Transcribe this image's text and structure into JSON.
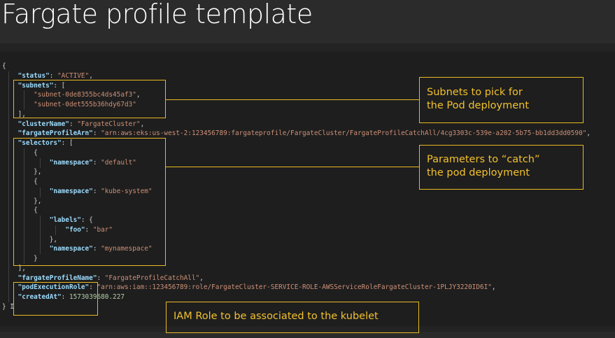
{
  "slide": {
    "title": "Fargate profile template"
  },
  "code_lines": [
    [
      {
        "t": "p",
        "v": "{"
      }
    ],
    [
      {
        "t": "p",
        "v": "    "
      },
      {
        "t": "k",
        "v": "\"status\""
      },
      {
        "t": "p",
        "v": ": "
      },
      {
        "t": "s",
        "v": "\"ACTIVE\""
      },
      {
        "t": "p",
        "v": ","
      }
    ],
    [
      {
        "t": "p",
        "v": "    "
      },
      {
        "t": "k",
        "v": "\"subnets\""
      },
      {
        "t": "p",
        "v": ": ["
      }
    ],
    [
      {
        "t": "p",
        "v": "        "
      },
      {
        "t": "s",
        "v": "\"subnet-0de8355bc4ds45af3\""
      },
      {
        "t": "p",
        "v": ","
      }
    ],
    [
      {
        "t": "p",
        "v": "        "
      },
      {
        "t": "s",
        "v": "\"subnet-0det555b36hdy67d3\""
      }
    ],
    [
      {
        "t": "p",
        "v": "    ],"
      }
    ],
    [
      {
        "t": "p",
        "v": "    "
      },
      {
        "t": "k",
        "v": "\"clusterName\""
      },
      {
        "t": "p",
        "v": ": "
      },
      {
        "t": "s",
        "v": "\"FargateCluster\""
      },
      {
        "t": "p",
        "v": ","
      }
    ],
    [
      {
        "t": "p",
        "v": "    "
      },
      {
        "t": "k",
        "v": "\"fargateProfileArn\""
      },
      {
        "t": "p",
        "v": ": "
      },
      {
        "t": "s",
        "v": "\"arn:aws:eks:us-west-2:123456789:fargateprofile/FargateCluster/FargateProfileCatchAll/4cg3303c-539e-a202-5b75-bb1dd3dd0590\""
      },
      {
        "t": "p",
        "v": ","
      }
    ],
    [
      {
        "t": "p",
        "v": "    "
      },
      {
        "t": "k",
        "v": "\"selectors\""
      },
      {
        "t": "p",
        "v": ": ["
      }
    ],
    [
      {
        "t": "p",
        "v": "        {"
      }
    ],
    [
      {
        "t": "p",
        "v": "            "
      },
      {
        "t": "k",
        "v": "\"namespace\""
      },
      {
        "t": "p",
        "v": ": "
      },
      {
        "t": "s",
        "v": "\"default\""
      }
    ],
    [
      {
        "t": "p",
        "v": "        },"
      }
    ],
    [
      {
        "t": "p",
        "v": "        {"
      }
    ],
    [
      {
        "t": "p",
        "v": "            "
      },
      {
        "t": "k",
        "v": "\"namespace\""
      },
      {
        "t": "p",
        "v": ": "
      },
      {
        "t": "s",
        "v": "\"kube-system\""
      }
    ],
    [
      {
        "t": "p",
        "v": "        },"
      }
    ],
    [
      {
        "t": "p",
        "v": "        {"
      }
    ],
    [
      {
        "t": "p",
        "v": "            "
      },
      {
        "t": "k",
        "v": "\"labels\""
      },
      {
        "t": "p",
        "v": ": {"
      }
    ],
    [
      {
        "t": "p",
        "v": "                "
      },
      {
        "t": "k",
        "v": "\"foo\""
      },
      {
        "t": "p",
        "v": ": "
      },
      {
        "t": "s",
        "v": "\"bar\""
      }
    ],
    [
      {
        "t": "p",
        "v": "            },"
      }
    ],
    [
      {
        "t": "p",
        "v": "            "
      },
      {
        "t": "k",
        "v": "\"namespace\""
      },
      {
        "t": "p",
        "v": ": "
      },
      {
        "t": "s",
        "v": "\"mynamespace\""
      }
    ],
    [
      {
        "t": "p",
        "v": "        }"
      }
    ],
    [
      {
        "t": "p",
        "v": "    ],"
      }
    ],
    [
      {
        "t": "p",
        "v": "    "
      },
      {
        "t": "k",
        "v": "\"fargateProfileName\""
      },
      {
        "t": "p",
        "v": ": "
      },
      {
        "t": "s",
        "v": "\"FargateProfileCatchAll\""
      },
      {
        "t": "p",
        "v": ","
      }
    ],
    [
      {
        "t": "p",
        "v": "    "
      },
      {
        "t": "k",
        "v": "\"podExecutionRole\""
      },
      {
        "t": "p",
        "v": ": "
      },
      {
        "t": "s",
        "v": "\"arn:aws:iam::123456789:role/FargateCluster-SERVICE-ROLE-AWSServiceRoleFargateCluster-1PLJY3220ID6I\""
      },
      {
        "t": "p",
        "v": ","
      }
    ],
    [
      {
        "t": "p",
        "v": "    "
      },
      {
        "t": "k",
        "v": "\"createdAt\""
      },
      {
        "t": "p",
        "v": ": "
      },
      {
        "t": "n",
        "v": "1573039680.227"
      }
    ],
    [
      {
        "t": "p",
        "v": "} "
      },
      {
        "t": "c",
        "v": "I"
      }
    ]
  ],
  "callouts": {
    "subnets": {
      "line1": "Subnets to pick for",
      "line2": "the Pod deployment"
    },
    "selectors": {
      "line1": "Parameters to “catch”",
      "line2": "the pod deployment"
    },
    "role": {
      "line1": "IAM Role to be associated to the kubelet"
    }
  },
  "colors": {
    "accent": "#e8b923",
    "callout_text": "#f2c12e",
    "background": "#1e1e1e",
    "json_key": "#9cdcfe",
    "json_string": "#ce9178",
    "json_number": "#b5cea8"
  }
}
